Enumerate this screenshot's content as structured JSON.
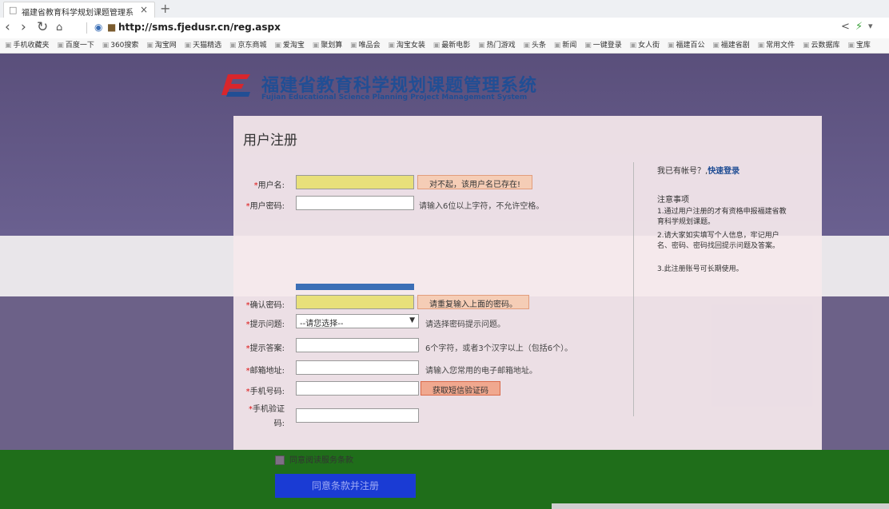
{
  "browser": {
    "tab_title": "福建省教育科学规划课题管理系",
    "url": "http://sms.fjedusr.cn/reg.aspx",
    "bookmarks": [
      "手机收藏夹",
      "百度一下",
      "360搜索",
      "淘宝网",
      "天猫精选",
      "京东商城",
      "爱淘宝",
      "聚划算",
      "唯品会",
      "淘宝女装",
      "最新电影",
      "热门游戏",
      "头条",
      "新闻",
      "一键登录",
      "女人街",
      "福建百公",
      "福建省剧",
      "常用文件",
      "云数据库",
      "宝库"
    ]
  },
  "site": {
    "logo_cn": "福建省教育科学规划课题管理系统",
    "logo_en": "Fujian Educational Science Planning Project Management System"
  },
  "form": {
    "title": "用户注册",
    "username_label": "用户名:",
    "username_error": "对不起，该用户名已存在!",
    "password_label": "用户密码:",
    "password_hint": "请输入6位以上字符，不允许空格。",
    "confirm_label": "确认密码:",
    "confirm_hint": "请重复输入上面的密码。",
    "question_label": "提示问题:",
    "question_value": "--请您选择--",
    "question_hint": "请选择密码提示问题。",
    "answer_label": "提示答案:",
    "answer_hint": "6个字符，或者3个汉字以上（包括6个）。",
    "email_label": "邮箱地址:",
    "email_hint": "请输入您常用的电子邮箱地址。",
    "phone_label": "手机号码:",
    "sms_button": "获取短信验证码",
    "code_label_1": "手机验证",
    "code_label_2": "码:",
    "agree_label": "同意阅读服务条款",
    "submit_label": "同意条款并注册"
  },
  "side": {
    "login_prompt": "我已有帐号？,",
    "login_link": "快速登录",
    "notes_title": "注意事项",
    "notes": [
      "1.通过用户注册的才有资格申报福建省教育科学规划课题。",
      "2.请大家如实填写个人信息，牢记用户名、密码、密码找回提示问题及答案。",
      "3.此注册账号可长期使用。"
    ]
  }
}
